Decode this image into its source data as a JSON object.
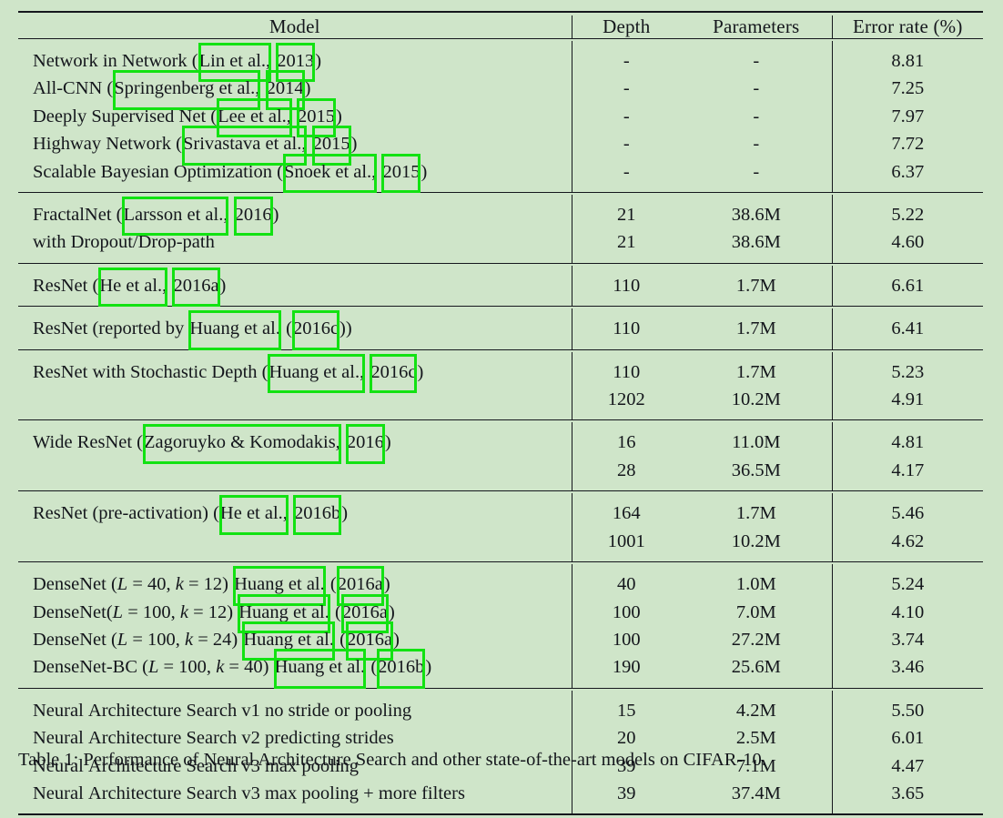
{
  "colors": {
    "page_background": "#cfe5c9",
    "rule": "#15171d",
    "text": "#14161c",
    "annotation_box": "#12e212"
  },
  "table": {
    "columns": [
      {
        "key": "model",
        "label": "Model"
      },
      {
        "key": "depth",
        "label": "Depth"
      },
      {
        "key": "parameters",
        "label": "Parameters"
      },
      {
        "key": "error_rate",
        "label": "Error rate (%)"
      }
    ],
    "groups": [
      {
        "rows": [
          {
            "model_text": "Network in Network (Lin et al., 2013)",
            "model_parts": [
              {
                "t": "Network in Network (",
                "cite": false
              },
              {
                "t": "Lin et al.,",
                "cite": true
              },
              {
                "t": " ",
                "cite": false
              },
              {
                "t": "2013",
                "cite": true
              },
              {
                "t": ")",
                "cite": false
              }
            ],
            "depth": "-",
            "parameters": "-",
            "error_rate": "8.81"
          },
          {
            "model_text": "All-CNN (Springenberg et al., 2014)",
            "model_parts": [
              {
                "t": "All-CNN (",
                "cite": false
              },
              {
                "t": "Springenberg et al.,",
                "cite": true
              },
              {
                "t": " ",
                "cite": false
              },
              {
                "t": "2014",
                "cite": true
              },
              {
                "t": ")",
                "cite": false
              }
            ],
            "depth": "-",
            "parameters": "-",
            "error_rate": "7.25"
          },
          {
            "model_text": "Deeply Supervised Net (Lee et al., 2015)",
            "model_parts": [
              {
                "t": "Deeply Supervised Net (",
                "cite": false
              },
              {
                "t": "Lee et al.,",
                "cite": true
              },
              {
                "t": " ",
                "cite": false
              },
              {
                "t": "2015",
                "cite": true
              },
              {
                "t": ")",
                "cite": false
              }
            ],
            "depth": "-",
            "parameters": "-",
            "error_rate": "7.97"
          },
          {
            "model_text": "Highway Network (Srivastava et al., 2015)",
            "model_parts": [
              {
                "t": "Highway Network (",
                "cite": false
              },
              {
                "t": "Srivastava et al.,",
                "cite": true
              },
              {
                "t": " ",
                "cite": false
              },
              {
                "t": "2015",
                "cite": true
              },
              {
                "t": ")",
                "cite": false
              }
            ],
            "depth": "-",
            "parameters": "-",
            "error_rate": "7.72"
          },
          {
            "model_text": "Scalable Bayesian Optimization (Snoek et al., 2015)",
            "model_parts": [
              {
                "t": "Scalable Bayesian Optimization (",
                "cite": false
              },
              {
                "t": "Snoek et al.,",
                "cite": true
              },
              {
                "t": " ",
                "cite": false
              },
              {
                "t": "2015",
                "cite": true
              },
              {
                "t": ")",
                "cite": false
              }
            ],
            "depth": "-",
            "parameters": "-",
            "error_rate": "6.37"
          }
        ]
      },
      {
        "rows": [
          {
            "model_text": "FractalNet (Larsson et al., 2016)",
            "model_parts": [
              {
                "t": "FractalNet (",
                "cite": false
              },
              {
                "t": "Larsson et al.,",
                "cite": true
              },
              {
                "t": " ",
                "cite": false
              },
              {
                "t": "2016",
                "cite": true
              },
              {
                "t": ")",
                "cite": false
              }
            ],
            "depth": "21",
            "parameters": "38.6M",
            "error_rate": "5.22"
          },
          {
            "model_text": "with Dropout/Drop-path",
            "model_parts": [
              {
                "t": "with Dropout/Drop-path",
                "cite": false
              }
            ],
            "depth": "21",
            "parameters": "38.6M",
            "error_rate": "4.60"
          }
        ]
      },
      {
        "rows": [
          {
            "model_text": "ResNet (He et al., 2016a)",
            "model_parts": [
              {
                "t": "ResNet (",
                "cite": false
              },
              {
                "t": "He et al.,",
                "cite": true
              },
              {
                "t": " ",
                "cite": false
              },
              {
                "t": "2016a",
                "cite": true
              },
              {
                "t": ")",
                "cite": false
              }
            ],
            "depth": "110",
            "parameters": "1.7M",
            "error_rate": "6.61"
          }
        ]
      },
      {
        "rows": [
          {
            "model_text": "ResNet (reported by Huang et al. (2016c))",
            "model_parts": [
              {
                "t": "ResNet (reported by ",
                "cite": false
              },
              {
                "t": "Huang et al.",
                "cite": true
              },
              {
                "t": " (",
                "cite": false
              },
              {
                "t": "2016c",
                "cite": true
              },
              {
                "t": "))",
                "cite": false
              }
            ],
            "depth": "110",
            "parameters": "1.7M",
            "error_rate": "6.41"
          }
        ]
      },
      {
        "rows": [
          {
            "model_text": "ResNet with Stochastic Depth (Huang et al., 2016c)",
            "model_parts": [
              {
                "t": "ResNet with Stochastic Depth (",
                "cite": false
              },
              {
                "t": "Huang et al.,",
                "cite": true
              },
              {
                "t": " ",
                "cite": false
              },
              {
                "t": "2016c",
                "cite": true
              },
              {
                "t": ")",
                "cite": false
              }
            ],
            "depth": "110",
            "parameters": "1.7M",
            "error_rate": "5.23"
          },
          {
            "model_text": "",
            "model_parts": [],
            "depth": "1202",
            "parameters": "10.2M",
            "error_rate": "4.91"
          }
        ]
      },
      {
        "rows": [
          {
            "model_text": "Wide ResNet (Zagoruyko & Komodakis, 2016)",
            "model_parts": [
              {
                "t": "Wide ResNet (",
                "cite": false
              },
              {
                "t": "Zagoruyko & Komodakis,",
                "cite": true
              },
              {
                "t": " ",
                "cite": false
              },
              {
                "t": "2016",
                "cite": true
              },
              {
                "t": ")",
                "cite": false
              }
            ],
            "depth": "16",
            "parameters": "11.0M",
            "error_rate": "4.81"
          },
          {
            "model_text": "",
            "model_parts": [],
            "depth": "28",
            "parameters": "36.5M",
            "error_rate": "4.17"
          }
        ]
      },
      {
        "rows": [
          {
            "model_text": "ResNet (pre-activation) (He et al., 2016b)",
            "model_parts": [
              {
                "t": "ResNet (pre-activation) (",
                "cite": false
              },
              {
                "t": "He et al.,",
                "cite": true
              },
              {
                "t": " ",
                "cite": false
              },
              {
                "t": "2016b",
                "cite": true
              },
              {
                "t": ")",
                "cite": false
              }
            ],
            "depth": "164",
            "parameters": "1.7M",
            "error_rate": "5.46"
          },
          {
            "model_text": "",
            "model_parts": [],
            "depth": "1001",
            "parameters": "10.2M",
            "error_rate": "4.62"
          }
        ]
      },
      {
        "rows": [
          {
            "model_text": "DenseNet (L = 40, k = 12) Huang et al. (2016a)",
            "model_parts": [
              {
                "t": "DenseNet (",
                "cite": false
              },
              {
                "t": "L",
                "cite": false,
                "math": true
              },
              {
                "t": " = 40, ",
                "cite": false
              },
              {
                "t": "k",
                "cite": false,
                "math": true
              },
              {
                "t": " = 12) ",
                "cite": false
              },
              {
                "t": "Huang et al.",
                "cite": true
              },
              {
                "t": " (",
                "cite": false
              },
              {
                "t": "2016a",
                "cite": true
              },
              {
                "t": ")",
                "cite": false
              }
            ],
            "depth": "40",
            "parameters": "1.0M",
            "error_rate": "5.24"
          },
          {
            "model_text": "DenseNet(L = 100, k = 12) Huang et al. (2016a)",
            "model_parts": [
              {
                "t": "DenseNet(",
                "cite": false
              },
              {
                "t": "L",
                "cite": false,
                "math": true
              },
              {
                "t": " = 100, ",
                "cite": false
              },
              {
                "t": "k",
                "cite": false,
                "math": true
              },
              {
                "t": " = 12) ",
                "cite": false
              },
              {
                "t": "Huang et al.",
                "cite": true
              },
              {
                "t": " (",
                "cite": false
              },
              {
                "t": "2016a",
                "cite": true
              },
              {
                "t": ")",
                "cite": false
              }
            ],
            "depth": "100",
            "parameters": "7.0M",
            "error_rate": "4.10"
          },
          {
            "model_text": "DenseNet (L = 100, k = 24) Huang et al. (2016a)",
            "model_parts": [
              {
                "t": "DenseNet (",
                "cite": false
              },
              {
                "t": "L",
                "cite": false,
                "math": true
              },
              {
                "t": " = 100, ",
                "cite": false
              },
              {
                "t": "k",
                "cite": false,
                "math": true
              },
              {
                "t": " = 24) ",
                "cite": false
              },
              {
                "t": "Huang et al.",
                "cite": true
              },
              {
                "t": " (",
                "cite": false
              },
              {
                "t": "2016a",
                "cite": true
              },
              {
                "t": ")",
                "cite": false
              }
            ],
            "depth": "100",
            "parameters": "27.2M",
            "error_rate": "3.74"
          },
          {
            "model_text": "DenseNet-BC (L = 100, k = 40) Huang et al. (2016b)",
            "model_parts": [
              {
                "t": "DenseNet-BC (",
                "cite": false
              },
              {
                "t": "L",
                "cite": false,
                "math": true
              },
              {
                "t": " = 100, ",
                "cite": false
              },
              {
                "t": "k",
                "cite": false,
                "math": true
              },
              {
                "t": " = 40) ",
                "cite": false
              },
              {
                "t": "Huang et al.",
                "cite": true
              },
              {
                "t": " (",
                "cite": false
              },
              {
                "t": "2016b",
                "cite": true
              },
              {
                "t": ")",
                "cite": false
              }
            ],
            "depth": "190",
            "parameters": "25.6M",
            "error_rate": "3.46"
          }
        ]
      },
      {
        "rows": [
          {
            "model_text": "Neural Architecture Search v1 no stride or pooling",
            "model_parts": [
              {
                "t": "Neural Architecture Search v1 no stride or pooling",
                "cite": false
              }
            ],
            "depth": "15",
            "parameters": "4.2M",
            "error_rate": "5.50"
          },
          {
            "model_text": "Neural Architecture Search v2 predicting strides",
            "model_parts": [
              {
                "t": "Neural Architecture Search v2 predicting strides",
                "cite": false
              }
            ],
            "depth": "20",
            "parameters": "2.5M",
            "error_rate": "6.01"
          },
          {
            "model_text": "Neural Architecture Search v3 max pooling",
            "model_parts": [
              {
                "t": "Neural Architecture Search v3 max pooling",
                "cite": false
              }
            ],
            "depth": "39",
            "parameters": "7.1M",
            "error_rate": "4.47"
          },
          {
            "model_text": "Neural Architecture Search v3 max pooling + more filters",
            "model_parts": [
              {
                "t": "Neural Architecture Search v3 max pooling + more filters",
                "cite": false
              }
            ],
            "depth": "39",
            "parameters": "37.4M",
            "error_rate": "3.65"
          }
        ]
      }
    ]
  },
  "caption": {
    "text": "Table 1: Performance of Neural Architecture Search and other state-of-the-art models on CIFAR-10."
  }
}
